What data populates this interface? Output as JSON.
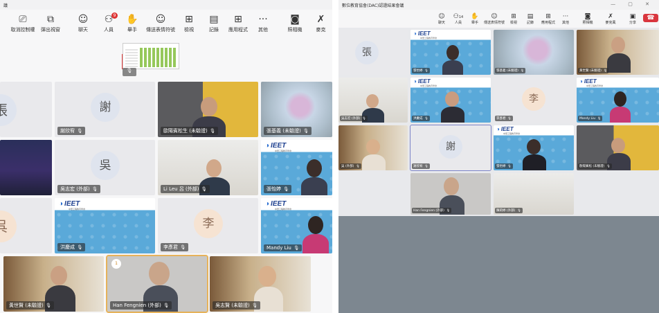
{
  "left": {
    "title": "議",
    "toolbar": [
      {
        "id": "stop-share",
        "icon": "⎚",
        "label": "取消控制權"
      },
      {
        "id": "popout",
        "icon": "⧉",
        "label": "彈出視窗"
      },
      {
        "id": "chat",
        "icon": "☺",
        "label": "聊天"
      },
      {
        "id": "people",
        "icon": "⚇",
        "label": "人員",
        "badge": "9"
      },
      {
        "id": "raise",
        "icon": "✋",
        "label": "舉手"
      },
      {
        "id": "react",
        "icon": "☺",
        "label": "傳送表情符號"
      },
      {
        "id": "view",
        "icon": "⊞",
        "label": "檢視"
      },
      {
        "id": "notes",
        "icon": "▤",
        "label": "記錄"
      },
      {
        "id": "apps",
        "icon": "⊞",
        "label": "應用程式"
      },
      {
        "id": "more",
        "icon": "···",
        "label": "其他"
      },
      {
        "id": "camera",
        "icon": "◙",
        "label": "照相機"
      },
      {
        "id": "mic",
        "icon": "✗",
        "label": "麥克"
      }
    ],
    "avatars": {
      "zhang": "張",
      "xie": "謝",
      "wu": "吳",
      "li": "李",
      "shi": "呉"
    },
    "names": {
      "xie": "謝欣宥",
      "ou": "歐陽賓松生 (未驗證)",
      "zhang_jy": "張基義 (未驗證)",
      "wu": "吳志宏 (外部)",
      "li_leu": "Li Leu 呂 (外部)",
      "zhang_yt": "張怡婷",
      "hong": "洪慶成",
      "li_ze": "李彥君",
      "mandy": "Mandy Liu",
      "huang": "黃世賢 (未驗證)",
      "han": "Han Fengnien (外部)",
      "wu_zhi": "吳志賢 (未驗證)"
    },
    "raise_count": "1",
    "ieet": {
      "logo": "IEET",
      "sub": "中華工程教育學會"
    }
  },
  "right": {
    "title": "數位教育協會(DAC)認證結果會議",
    "window_controls": "— ▢ ✕",
    "toolbar": [
      {
        "id": "chat",
        "icon": "☺",
        "label": "聊天"
      },
      {
        "id": "people",
        "icon": "⚇",
        "label": "人員",
        "badge": "14"
      },
      {
        "id": "raise",
        "icon": "✋",
        "label": "舉手"
      },
      {
        "id": "react",
        "icon": "☺",
        "label": "傳送表情符號"
      },
      {
        "id": "view",
        "icon": "⊞",
        "label": "檢視"
      },
      {
        "id": "notes",
        "icon": "▤",
        "label": "記錄"
      },
      {
        "id": "apps",
        "icon": "⊞",
        "label": "應用程式"
      },
      {
        "id": "more",
        "icon": "···",
        "label": "其他"
      },
      {
        "id": "camera",
        "icon": "◙",
        "label": "照相機"
      },
      {
        "id": "mic",
        "icon": "✗",
        "label": "麥克風"
      },
      {
        "id": "share",
        "icon": "▣",
        "label": "分享"
      },
      {
        "id": "leave",
        "icon": "☎",
        "label": ""
      }
    ],
    "avatars": {
      "zhang": "張",
      "li": "李",
      "xie": "謝"
    },
    "names": {
      "r1": "張怡婷",
      "r2": "張基義 (未驗證)",
      "r3": "黃世賢 (未驗證)",
      "r4": "吳志宏 (外部)",
      "r5": "洪慶成",
      "r6": "李彥君",
      "r7": "Mandy Liu",
      "r8": "吳 (外部)",
      "r9": "謝欣宥",
      "r10": "張怡婷",
      "r11": "歐陽賓松 (未驗證)",
      "r12": "Han Fengnien (外部)",
      "r13": "陳莉婷 (外部)"
    },
    "ieet": {
      "logo": "IEET",
      "sub": "中華工程教育學會"
    }
  },
  "icons": {
    "mic_muted": "🎙"
  }
}
